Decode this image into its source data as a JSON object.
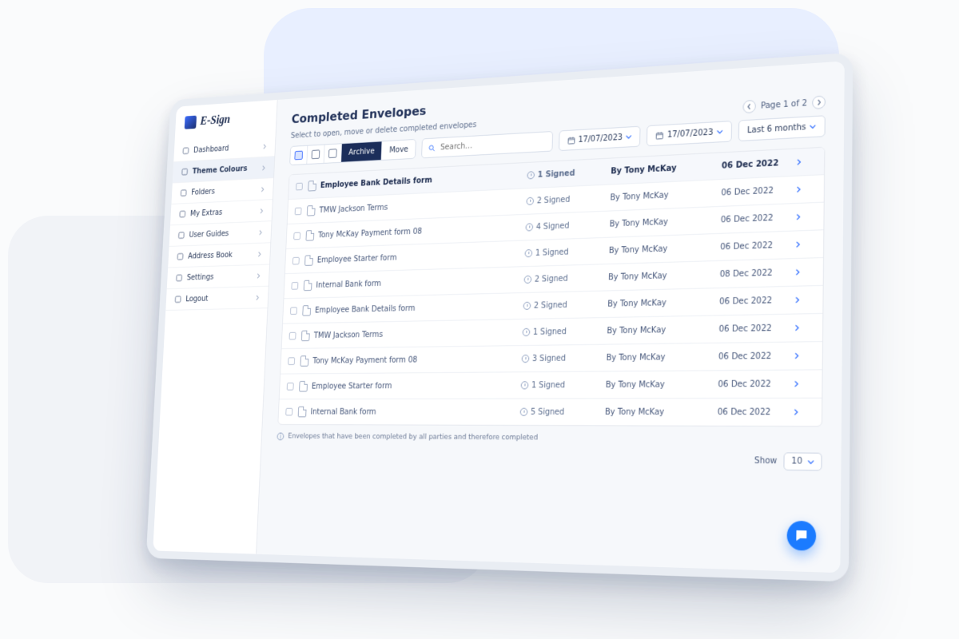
{
  "brand": {
    "name": "E-Sign"
  },
  "sidebar": {
    "items": [
      {
        "label": "Dashboard",
        "icon": "grid-icon"
      },
      {
        "label": "Theme Colours",
        "icon": "palette-icon",
        "active": true
      },
      {
        "label": "Folders",
        "icon": "folder-icon"
      },
      {
        "label": "My Extras",
        "icon": "plus-icon"
      },
      {
        "label": "User Guides",
        "icon": "book-icon"
      },
      {
        "label": "Address Book",
        "icon": "contacts-icon"
      },
      {
        "label": "Settings",
        "icon": "gear-icon"
      },
      {
        "label": "Logout",
        "icon": "logout-icon"
      }
    ]
  },
  "page": {
    "title": "Completed Envelopes",
    "subtitle": "Select to open, move or delete completed envelopes",
    "footnote": "Envelopes that have been completed by all parties and therefore completed"
  },
  "toolbar": {
    "buttons": {
      "archive": "Archive",
      "move": "Move"
    },
    "search_placeholder": "Search…",
    "date_from": "17/07/2023",
    "date_to": "17/07/2023",
    "range": "Last 6 months"
  },
  "pager": {
    "label": "Page 1 of 2"
  },
  "show": {
    "label": "Show",
    "value": "10"
  },
  "rows": [
    {
      "name": "Employee Bank Details form",
      "signed": "1 Signed",
      "by": "By Tony McKay",
      "date": "06 Dec 2022"
    },
    {
      "name": "TMW Jackson Terms",
      "signed": "2 Signed",
      "by": "By Tony McKay",
      "date": "06 Dec 2022"
    },
    {
      "name": "Tony McKay Payment form 08",
      "signed": "4 Signed",
      "by": "By Tony McKay",
      "date": "06 Dec 2022"
    },
    {
      "name": "Employee Starter form",
      "signed": "1 Signed",
      "by": "By Tony McKay",
      "date": "06 Dec 2022"
    },
    {
      "name": "Internal Bank form",
      "signed": "2 Signed",
      "by": "By Tony McKay",
      "date": "08 Dec 2022"
    },
    {
      "name": "Employee Bank Details form",
      "signed": "2 Signed",
      "by": "By Tony McKay",
      "date": "06 Dec 2022"
    },
    {
      "name": "TMW Jackson Terms",
      "signed": "1 Signed",
      "by": "By Tony McKay",
      "date": "06 Dec 2022"
    },
    {
      "name": "Tony McKay Payment form 08",
      "signed": "3 Signed",
      "by": "By Tony McKay",
      "date": "06 Dec 2022"
    },
    {
      "name": "Employee Starter form",
      "signed": "1 Signed",
      "by": "By Tony McKay",
      "date": "06 Dec 2022"
    },
    {
      "name": "Internal Bank form",
      "signed": "5 Signed",
      "by": "By Tony McKay",
      "date": "06 Dec 2022"
    }
  ]
}
